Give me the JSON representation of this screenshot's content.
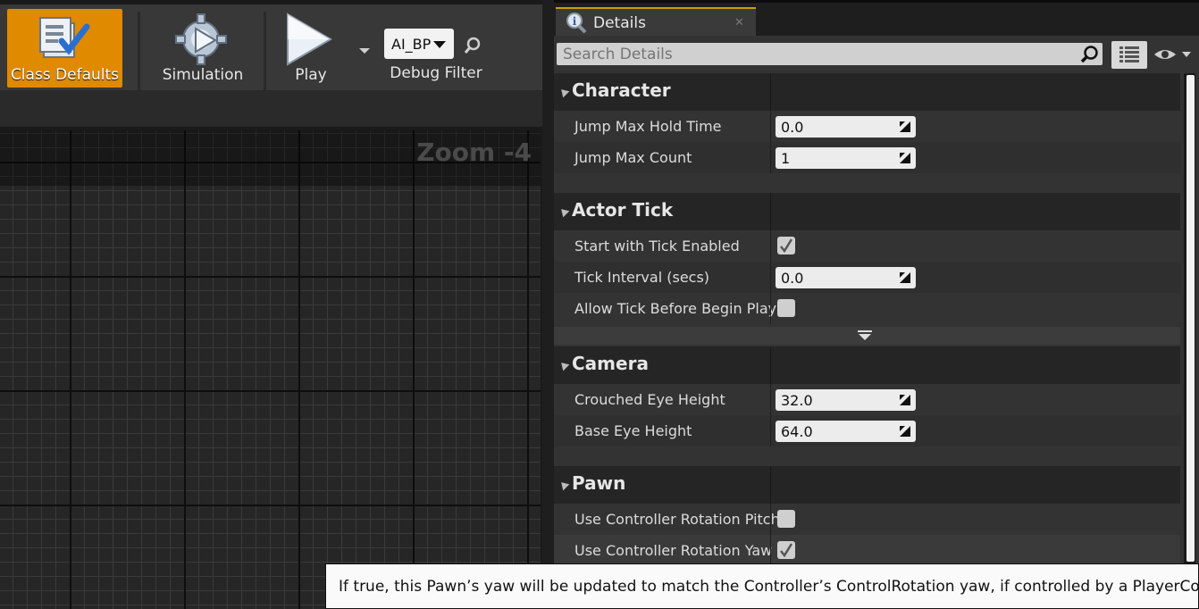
{
  "toolbar": {
    "class_defaults_label": "Class Defaults",
    "simulation_label": "Simulation",
    "play_label": "Play",
    "debug_object": "AI_BP",
    "debug_filter_label": "Debug Filter"
  },
  "graph": {
    "zoom_label": "Zoom -4"
  },
  "details": {
    "tab_title": "Details",
    "search_placeholder": "Search Details",
    "categories": [
      {
        "name": "Character"
      },
      {
        "name": "Actor Tick"
      },
      {
        "name": "Camera"
      },
      {
        "name": "Pawn"
      }
    ],
    "character": {
      "jump_max_hold_time": {
        "label": "Jump Max Hold Time",
        "value": "0.0"
      },
      "jump_max_count": {
        "label": "Jump Max Count",
        "value": "1"
      }
    },
    "actor_tick": {
      "start_with_tick_enabled": {
        "label": "Start with Tick Enabled",
        "checked": true
      },
      "tick_interval": {
        "label": "Tick Interval (secs)",
        "value": "0.0"
      },
      "allow_tick_before_begin_play": {
        "label": "Allow Tick Before Begin Play",
        "checked": false
      }
    },
    "camera": {
      "crouched_eye_height": {
        "label": "Crouched Eye Height",
        "value": "32.0"
      },
      "base_eye_height": {
        "label": "Base Eye Height",
        "value": "64.0"
      }
    },
    "pawn": {
      "use_controller_rotation_pitch": {
        "label": "Use Controller Rotation Pitch",
        "checked": false
      },
      "use_controller_rotation_yaw": {
        "label": "Use Controller Rotation Yaw",
        "checked": true
      }
    }
  },
  "tooltip": {
    "text": "If true, this Pawn’s yaw will be updated to match the Controller’s ControlRotation yaw, if controlled by a PlayerController."
  },
  "colors": {
    "accent_orange": "#e08a00",
    "tab_highlight": "#c8a000",
    "panel_bg": "#333333",
    "category_bg": "#252525"
  },
  "icons": [
    "class-defaults-icon",
    "simulation-icon",
    "play-icon",
    "dropdown-caret-icon",
    "search-icon",
    "info-magnifier-icon",
    "close-icon",
    "list-view-icon",
    "eye-icon",
    "collapse-arrow-icon",
    "drag-handle-icon",
    "checkmark-icon",
    "expand-advanced-icon"
  ]
}
